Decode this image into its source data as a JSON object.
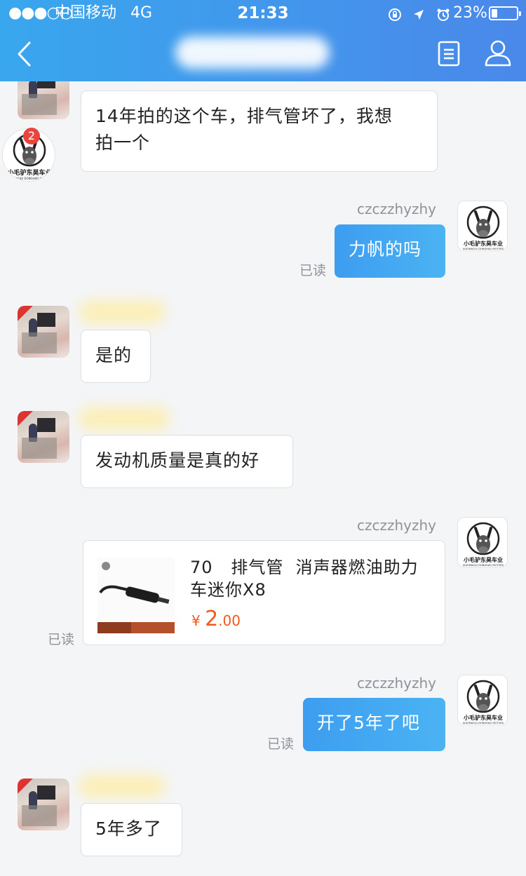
{
  "status_bar": {
    "signal": "●●●○○",
    "carrier": "中国移动",
    "network": "4G",
    "time": "21:33",
    "battery_pct": "23%",
    "battery_level": 0.23
  },
  "nav": {
    "back_icon": "chevron-left-icon",
    "doc_icon": "document-icon",
    "user_icon": "user-icon"
  },
  "messages": {
    "m1_text": "14年拍的这个车，排气管坏了，我想拍一个",
    "m1_line1": "14年拍的这个车，排气管坏了，我想",
    "m1_line2": "拍一个",
    "unread_count": "2",
    "logo_text": "小毛驴东昊车业",
    "logo_sub": "XIAOMAOLV DONGHAO MOTORS",
    "seller_name": "czczzhyzhy",
    "m2_text": "力帆的吗",
    "read_label": "已读",
    "m3_text": "是的",
    "m4_text": "发动机质量是真的好",
    "product": {
      "title": "70   排气管  消声器燃油助力车迷你X8",
      "title_line1": "70   排气管  消声器燃油助力",
      "title_line2": "车迷你X8",
      "currency": "¥",
      "price_int": "2",
      "price_dec": ".00"
    },
    "m5_text": "开了5年了吧",
    "m6_text": "5年多了"
  }
}
